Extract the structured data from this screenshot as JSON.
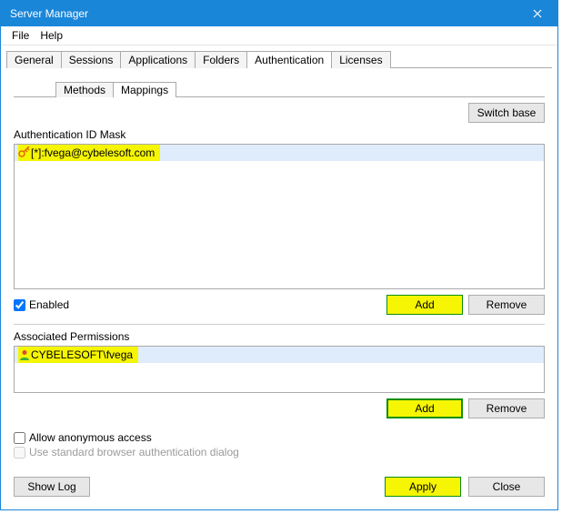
{
  "window": {
    "title": "Server Manager"
  },
  "menu": {
    "file": "File",
    "help": "Help"
  },
  "tabs": {
    "general": "General",
    "sessions": "Sessions",
    "applications": "Applications",
    "folders": "Folders",
    "authentication": "Authentication",
    "licenses": "Licenses",
    "active": "Authentication"
  },
  "subtabs": {
    "methods": "Methods",
    "mappings": "Mappings",
    "active": "Mappings"
  },
  "buttons": {
    "switch_base": "Switch base",
    "add": "Add",
    "remove": "Remove",
    "show_log": "Show Log",
    "apply": "Apply",
    "close": "Close"
  },
  "labels": {
    "auth_mask": "Authentication ID Mask",
    "assoc_perm": "Associated Permissions",
    "enabled": "Enabled",
    "anon": "Allow anonymous access",
    "browser_auth": "Use standard browser authentication dialog"
  },
  "mask_list": [
    {
      "id": "[*]:fvega@cybelesoft.com"
    }
  ],
  "perm_list": [
    {
      "id": "CYBELESOFT\\fvega"
    }
  ],
  "state": {
    "enabled_checked": true,
    "anon_checked": false,
    "browser_auth_checked": false
  }
}
